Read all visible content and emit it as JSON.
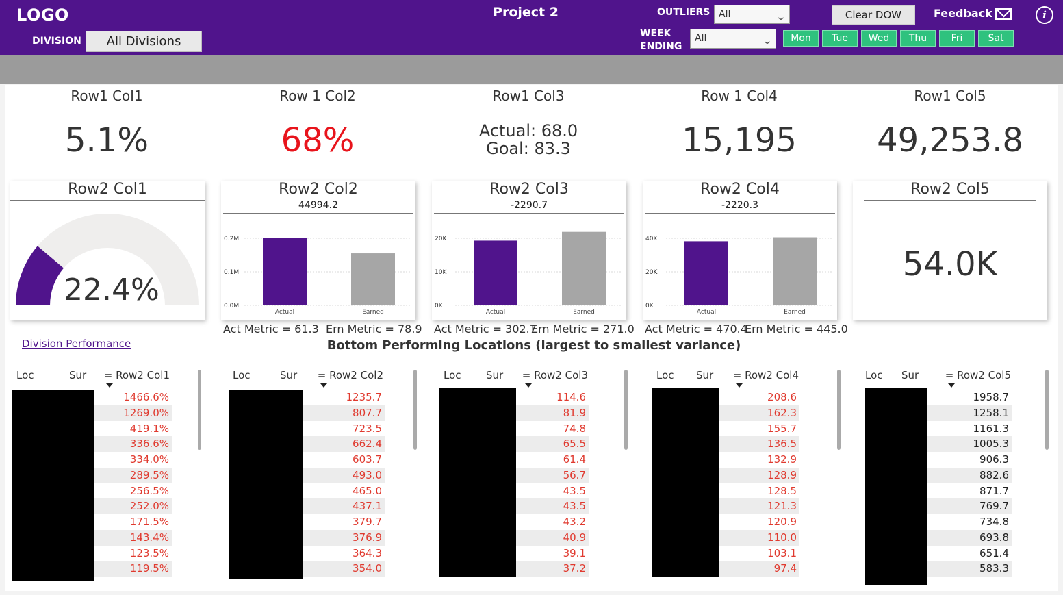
{
  "header": {
    "logo": "LOGO",
    "division_label": "DIVISION",
    "division_value": "All Divisions",
    "title": "Project 2",
    "outliers_label": "OUTLIERS",
    "outliers_value": "All",
    "week_ending_label_1": "WEEK",
    "week_ending_label_2": "ENDING",
    "week_ending_value": "All",
    "clear_label": "Clear DOW",
    "days": [
      "Mon",
      "Tue",
      "Wed",
      "Thu",
      "Fri",
      "Sat"
    ],
    "feedback_label": "Feedback"
  },
  "kpis": [
    {
      "title": "Row1 Col1",
      "value": "5.1%"
    },
    {
      "title": "Row 1 Col2",
      "value": "68%"
    },
    {
      "title": "Row1 Col3",
      "actual": "Actual: 68.0",
      "goal": "Goal: 83.3"
    },
    {
      "title": "Row 1 Col4",
      "value": "15,195"
    },
    {
      "title": "Row1 Col5",
      "value": "49,253.8"
    }
  ],
  "cards": {
    "c1": {
      "title": "Row2 Col1",
      "gauge_value": "22.4%",
      "gauge_fraction": 0.224
    },
    "c2": {
      "title": "Row2 Col2",
      "subtitle": "44994.2",
      "y_ticks": [
        "0.2M",
        "0.1M",
        "0.0M"
      ],
      "x_labels": [
        "Actual",
        "Earned"
      ],
      "values": [
        0.2,
        0.155
      ],
      "ymax": 0.2
    },
    "c3": {
      "title": "Row2 Col3",
      "subtitle": "-2290.7",
      "y_ticks": [
        "20K",
        "10K",
        "0K"
      ],
      "x_labels": [
        "Actual",
        "Earned"
      ],
      "values": [
        19300,
        21900
      ],
      "ymax": 20000
    },
    "c4": {
      "title": "Row2 Col4",
      "subtitle": "-2220.3",
      "y_ticks": [
        "40K",
        "20K",
        "0K"
      ],
      "x_labels": [
        "Actual",
        "Earned"
      ],
      "values": [
        38200,
        40600
      ],
      "ymax": 40000
    },
    "c5": {
      "title": "Row2 Col5",
      "value": "54.0K"
    }
  },
  "metrics": {
    "c2_act": "Act Metric =  61.3",
    "c2_ern": "Ern Metric = 78.9",
    "c3_act": "Act Metric = 302.7",
    "c3_ern": "Ern Metric = 271.0",
    "c4_act": "Act Metric = 470.4",
    "c4_ern": "Ern Metric =  445.0"
  },
  "division_link": "Division Performance",
  "bottom_title": "Bottom Performing Locations (largest to smallest variance)",
  "tables": [
    {
      "col_loc": "Loc",
      "col_sur": "Sur",
      "col_val": "= Row2 Col1",
      "values": [
        "1466.6%",
        "1269.0%",
        "419.1%",
        "336.6%",
        "334.0%",
        "289.5%",
        "256.5%",
        "252.0%",
        "171.5%",
        "143.4%",
        "123.5%",
        "119.5%"
      ]
    },
    {
      "col_loc": "Loc",
      "col_sur": "Sur",
      "col_val": "= Row2 Col2",
      "values": [
        "1235.7",
        "807.7",
        "723.5",
        "662.4",
        "603.7",
        "493.0",
        "465.0",
        "437.1",
        "379.7",
        "376.9",
        "364.3",
        "354.0"
      ]
    },
    {
      "col_loc": "Loc",
      "col_sur": "Sur",
      "col_val": "= Row2 Col3",
      "values": [
        "114.6",
        "81.9",
        "74.8",
        "65.5",
        "61.4",
        "56.7",
        "43.5",
        "43.5",
        "43.2",
        "40.9",
        "39.1",
        "37.2"
      ]
    },
    {
      "col_loc": "Loc",
      "col_sur": "Sur",
      "col_val": "= Row2 Col4",
      "values": [
        "208.6",
        "162.3",
        "155.7",
        "136.5",
        "132.9",
        "128.9",
        "128.5",
        "121.3",
        "120.9",
        "110.0",
        "103.1",
        "97.4"
      ]
    },
    {
      "col_loc": "Loc",
      "col_sur": "Sur",
      "col_val": "= Row2 Col5",
      "values": [
        "1958.7",
        "1258.1",
        "1161.3",
        "1005.3",
        "906.3",
        "882.6",
        "871.7",
        "769.7",
        "734.8",
        "693.8",
        "651.4",
        "583.3"
      ]
    }
  ],
  "colors": {
    "brand": "#50148c",
    "accent_green": "#2fc27e",
    "bar_actual": "#50148c",
    "bar_earned": "#a6a6a6",
    "negative": "#e03a2f",
    "kpi_red": "#e8141c"
  }
}
